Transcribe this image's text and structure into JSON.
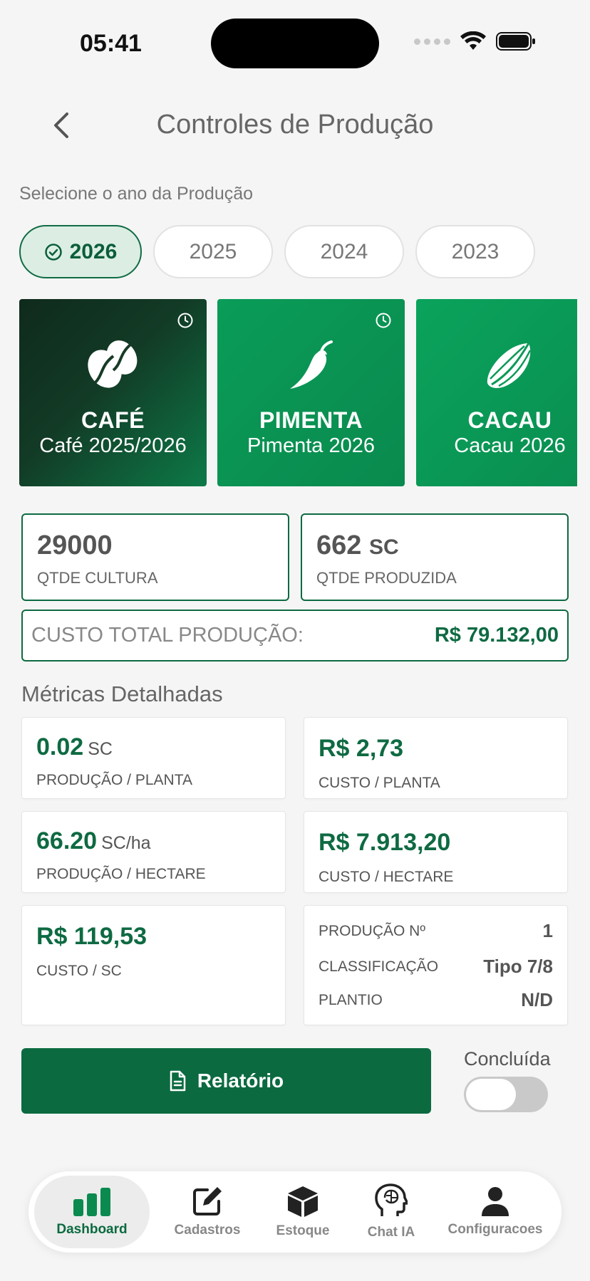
{
  "status": {
    "time": "05:41"
  },
  "header": {
    "title": "Controles de Produção"
  },
  "year_select": {
    "label": "Selecione o ano da Produção",
    "years": [
      "2026",
      "2025",
      "2024",
      "2023"
    ],
    "selected": "2026"
  },
  "crops": [
    {
      "name": "CAFÉ",
      "season": "Café 2025/2026",
      "icon": "coffee-bean-icon"
    },
    {
      "name": "PIMENTA",
      "season": "Pimenta 2026",
      "icon": "pepper-icon"
    },
    {
      "name": "CACAU",
      "season": "Cacau 2026",
      "icon": "cacao-pod-icon"
    }
  ],
  "summary": {
    "qtde_cultura": {
      "value": "29000",
      "label": "QTDE CULTURA"
    },
    "qtde_produzida": {
      "value": "662",
      "unit": "SC",
      "label": "QTDE PRODUZIDA"
    },
    "custo_total": {
      "label": "CUSTO TOTAL PRODUÇÃO:",
      "value": "R$ 79.132,00"
    }
  },
  "metrics": {
    "title": "Métricas Detalhadas",
    "producao_planta": {
      "value": "0.02",
      "unit": "SC",
      "label": "PRODUÇÃO / PLANTA"
    },
    "custo_planta": {
      "value": "R$ 2,73",
      "label": "CUSTO / PLANTA"
    },
    "producao_hectare": {
      "value": "66.20",
      "unit": "SC/ha",
      "label": "PRODUÇÃO / HECTARE"
    },
    "custo_hectare": {
      "value": "R$ 7.913,20",
      "label": "CUSTO / HECTARE"
    },
    "custo_sc": {
      "value": "R$ 119,53",
      "label": "CUSTO / SC"
    },
    "info": [
      {
        "key": "PRODUÇÃO Nº",
        "value": "1"
      },
      {
        "key": "CLASSIFICAÇÃO",
        "value": "Tipo 7/8"
      },
      {
        "key": "PLANTIO",
        "value": "N/D"
      }
    ]
  },
  "actions": {
    "report_label": "Relatório",
    "done_label": "Concluída",
    "done": false
  },
  "nav": [
    {
      "label": "Dashboard",
      "icon": "bar-chart-icon",
      "active": true
    },
    {
      "label": "Cadastros",
      "icon": "edit-icon"
    },
    {
      "label": "Estoque",
      "icon": "box-icon"
    },
    {
      "label": "Chat IA",
      "icon": "brain-head-icon"
    },
    {
      "label": "Configuracoes",
      "icon": "user-icon"
    }
  ],
  "colors": {
    "primary": "#0b6a40",
    "accent_green": "#0a9c58",
    "dark_card": "#0f2a1c"
  }
}
